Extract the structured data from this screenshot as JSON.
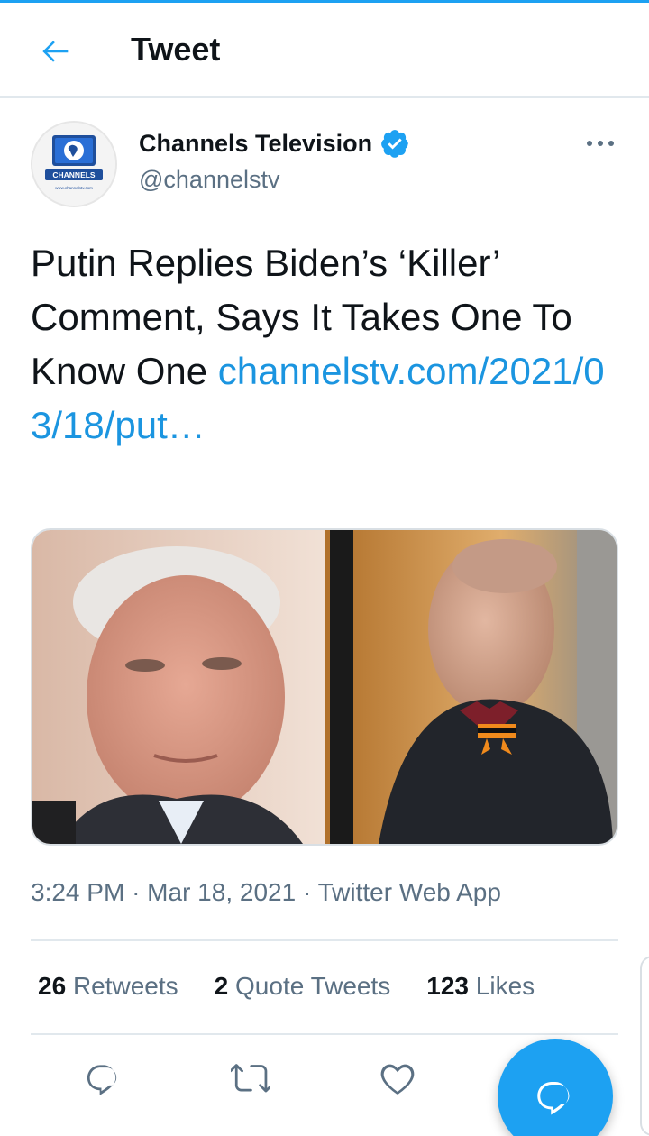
{
  "header": {
    "title": "Tweet",
    "back_icon": "arrow-left-icon"
  },
  "author": {
    "name": "Channels Television",
    "handle": "@channelstv",
    "verified": true,
    "avatar_text": "CHANNELS",
    "avatar_url_text": "www.channelstv.com"
  },
  "tweet": {
    "text": "Putin Replies Biden’s ‘Killer’ Comment, Says It Takes One To Know One",
    "link": "channelstv.com/2021/03/18/put…"
  },
  "meta": {
    "time": "3:24 PM",
    "separator": "·",
    "date": "Mar 18, 2021",
    "source": "Twitter Web App"
  },
  "stats": {
    "retweets_count": "26",
    "retweets_label": "Retweets",
    "quotes_count": "2",
    "quotes_label": "Quote Tweets",
    "likes_count": "123",
    "likes_label": "Likes"
  },
  "actions": {
    "reply_icon": "reply-icon",
    "retweet_icon": "retweet-icon",
    "like_icon": "heart-icon",
    "compose_icon": "compose-reply-icon"
  },
  "colors": {
    "accent": "#1da1f2",
    "link": "#1b95e0",
    "secondary_text": "#5b7083",
    "primary_text": "#0f1419",
    "divider": "#e1e8ed"
  }
}
